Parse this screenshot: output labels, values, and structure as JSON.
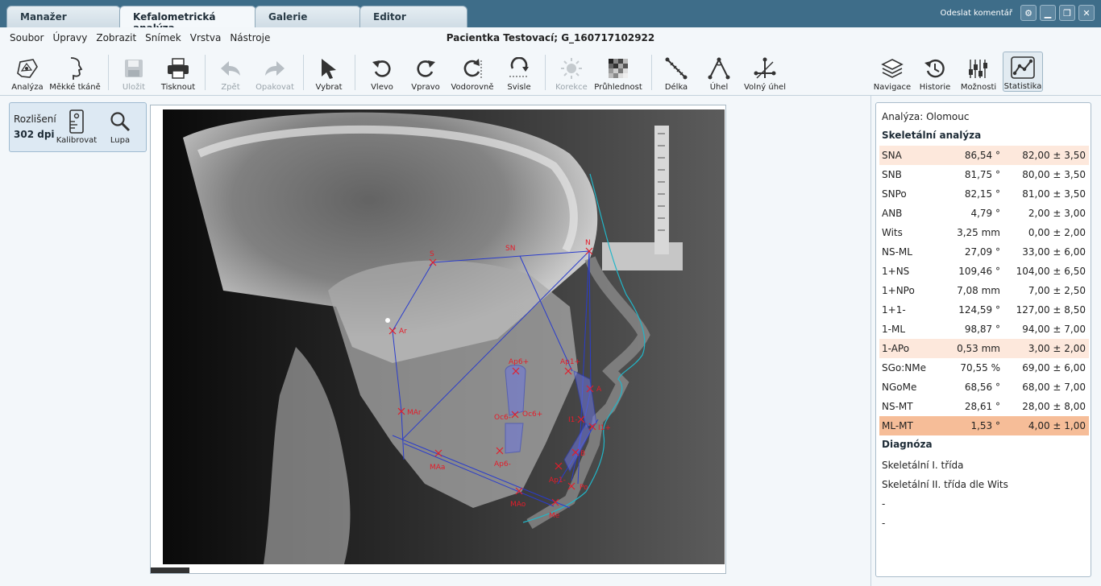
{
  "tabs": [
    "Manažer",
    "Kefalometrická analýza",
    "Galerie",
    "Editor"
  ],
  "window": {
    "feedback": "Odeslat komentář"
  },
  "menu": [
    "Soubor",
    "Úpravy",
    "Zobrazit",
    "Snímek",
    "Vrstva",
    "Nástroje"
  ],
  "patient": "Pacientka Testovací; G_160717102922",
  "toolbar": {
    "analyza": "Analýza",
    "mekke": "Měkké tkáně",
    "ulozit": "Uložit",
    "tisknout": "Tisknout",
    "zpet": "Zpět",
    "opakovat": "Opakovat",
    "vybrat": "Vybrat",
    "vlevo": "Vlevo",
    "vpravo": "Vpravo",
    "vodorovne": "Vodorovně",
    "svisle": "Svisle",
    "korekce": "Korekce",
    "pruhlednost": "Průhlednost",
    "delka": "Délka",
    "uhel": "Úhel",
    "volny": "Volný úhel",
    "navigace": "Navigace",
    "historie": "Historie",
    "moznosti": "Možnosti",
    "statistika": "Statistika"
  },
  "calibration": {
    "label": "Rozlišení",
    "dpi": "302 dpi",
    "kalibrovat": "Kalibrovat",
    "lupa": "Lupa"
  },
  "landmarks": {
    "S": "S",
    "SN": "SN",
    "N": "N",
    "Ar": "Ar",
    "MAr": "MAr",
    "MAa": "MAa",
    "MAo": "MAo",
    "Me": "Me",
    "Ap6p": "Ap6+",
    "Ap1p": "Ap1+",
    "A": "A",
    "Oc6m": "Oc6-",
    "Oc6p": "Oc6+",
    "I1m": "I1-",
    "I1p": "I1+",
    "Ap6m": "Ap6-",
    "B": "B",
    "Ap1m": "Ap1-",
    "Po": "Po"
  },
  "stats": {
    "title": "Analýza: Olomouc",
    "heading": "Skeletální analýza",
    "rows": [
      {
        "name": "SNA",
        "value": "86,54 °",
        "ref": "82,00 ± 3,50"
      },
      {
        "name": "SNB",
        "value": "81,75 °",
        "ref": "80,00 ± 3,50"
      },
      {
        "name": "SNPo",
        "value": "82,15 °",
        "ref": "81,00 ± 3,50"
      },
      {
        "name": "ANB",
        "value": "4,79 °",
        "ref": "2,00 ± 3,00"
      },
      {
        "name": "Wits",
        "value": "3,25 mm",
        "ref": "0,00 ± 2,00"
      },
      {
        "name": "NS-ML",
        "value": "27,09 °",
        "ref": "33,00 ± 6,00"
      },
      {
        "name": "1+NS",
        "value": "109,46 °",
        "ref": "104,00 ± 6,50"
      },
      {
        "name": "1+NPo",
        "value": "7,08 mm",
        "ref": "7,00 ± 2,50"
      },
      {
        "name": "1+1-",
        "value": "124,59 °",
        "ref": "127,00 ± 8,50"
      },
      {
        "name": "1-ML",
        "value": "98,87 °",
        "ref": "94,00 ± 7,00"
      },
      {
        "name": "1-APo",
        "value": "0,53 mm",
        "ref": "3,00 ± 2,00"
      },
      {
        "name": "SGo:NMe",
        "value": "70,55 %",
        "ref": "69,00 ± 6,00"
      },
      {
        "name": "NGoMe",
        "value": "68,56 °",
        "ref": "68,00 ± 7,00"
      },
      {
        "name": "NS-MT",
        "value": "28,61 °",
        "ref": "28,00 ± 8,00"
      },
      {
        "name": "ML-MT",
        "value": "1,53 °",
        "ref": "4,00 ± 1,00"
      }
    ],
    "diagnosis_heading": "Diagnóza",
    "diagnosis": [
      "Skeletální I. třída",
      "Skeletální II. třída dle Wits",
      "-",
      "-"
    ]
  }
}
